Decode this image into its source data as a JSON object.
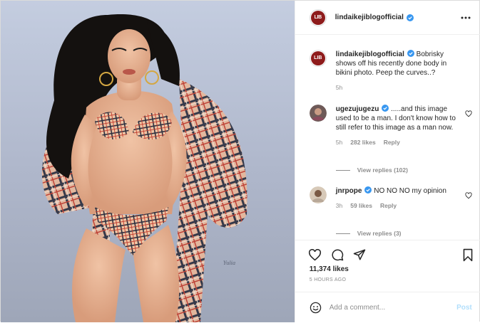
{
  "post": {
    "watermark": "Yulia",
    "colors": {
      "verified": "#3897f0",
      "brand": "#8e1b1b",
      "link_disabled": "#b2dffc"
    }
  },
  "header": {
    "avatar_text": "LIB",
    "username": "lindaikejiblogofficial",
    "more_icon": "more-horizontal-icon"
  },
  "caption": {
    "username": "lindaikejiblogofficial",
    "text": "Bobrisky shows off his recently done body in bikini photo. Peep the curves..?",
    "time": "5h"
  },
  "comments": [
    {
      "username": "ugezujugezu",
      "text": ".....and this image used to be a man. I don't know how to still refer to this image as a man now.",
      "time": "5h",
      "likes": "282 likes",
      "reply": "Reply",
      "view_replies": "View replies (102)"
    },
    {
      "username": "jnrpope",
      "text": "NO NO NO my opinion",
      "time": "3h",
      "likes": "59 likes",
      "reply": "Reply",
      "view_replies": "View replies (3)"
    }
  ],
  "actions": {
    "likes": "11,374 likes",
    "time": "5 HOURS AGO",
    "add_comment_placeholder": "Add a comment...",
    "post_label": "Post"
  }
}
